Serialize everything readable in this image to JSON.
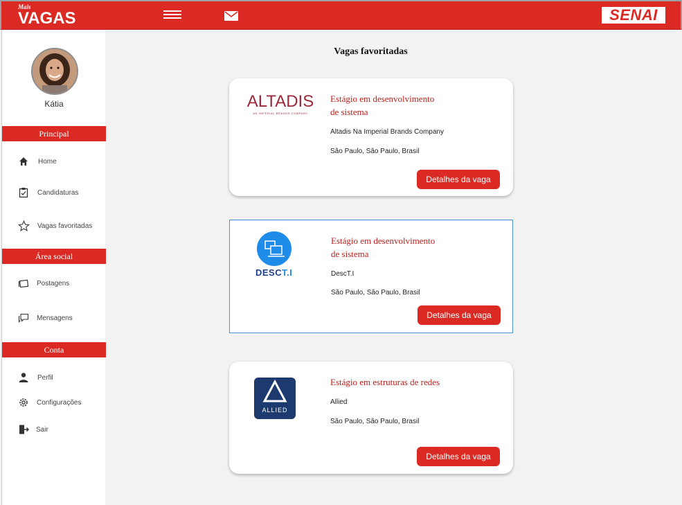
{
  "header": {
    "logo_small": "Mais",
    "logo_big": "VAGAS",
    "brand": "SENAI",
    "colors": {
      "primary": "#db2a24",
      "background": "#f2f2f2"
    },
    "icons": [
      "menu-icon",
      "mail-icon"
    ]
  },
  "user": {
    "name": "Kátia"
  },
  "sidebar": {
    "sections": [
      {
        "label": "Principal"
      },
      {
        "label": "Área social"
      },
      {
        "label": "Conta"
      }
    ],
    "items": [
      {
        "label": "Home",
        "icon": "home-icon"
      },
      {
        "label": "Candidaturas",
        "icon": "clipboard-check-icon"
      },
      {
        "label": "Vagas favoritadas",
        "icon": "star-icon"
      },
      {
        "label": "Postagens",
        "icon": "posts-icon"
      },
      {
        "label": "Mensagens",
        "icon": "chat-icon"
      },
      {
        "label": "Perfil",
        "icon": "person-icon"
      },
      {
        "label": "Configurações",
        "icon": "gear-icon"
      },
      {
        "label": "Sair",
        "icon": "logout-icon"
      }
    ]
  },
  "main": {
    "title": "Vagas favoritadas",
    "jobs": [
      {
        "title_line1": "Estágio em desenvolvimento",
        "title_line2": "de sistema",
        "company": "Altadis Na Imperial Brands Company",
        "location": "São Paulo, São Paulo, Brasil",
        "button": "Detalhes da vaga",
        "logo_text": "ALTADIS",
        "logo_sub": "AN IMPERIAL BRANDS COMPANY"
      },
      {
        "title_line1": "Estágio em desenvolvimento",
        "title_line2": "de sistema",
        "company": "DescT.I",
        "location": "São Paulo, São Paulo, Brasil",
        "button": "Detalhes da vaga",
        "logo_text_a": "DESC",
        "logo_text_b": "T.I"
      },
      {
        "title_line1": "Estágio em estruturas de redes",
        "title_line2": "",
        "company": "Allied",
        "location": "São Paulo, São Paulo, Brasil",
        "button": "Detalhes da vaga",
        "logo_text": "ALLIED"
      }
    ]
  }
}
